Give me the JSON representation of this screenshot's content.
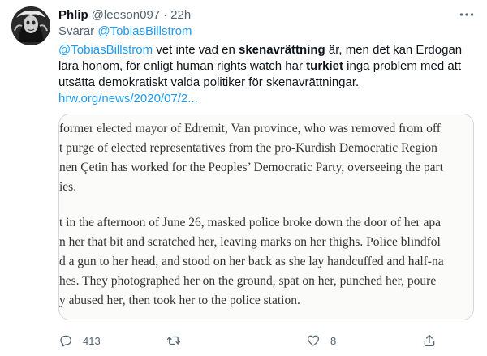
{
  "author": {
    "name": "Phlip",
    "handle": "@leeson097",
    "separator": "·",
    "time": "22h"
  },
  "reply": {
    "prefix": "Svarar",
    "mention": "@TobiasBillstrom"
  },
  "body": {
    "mention": "@TobiasBillstrom",
    "part1": " vet inte vad en ",
    "bold1": "skenavrättning",
    "part2": " är, men det kan Erdogan lära honom, för enligt human rights watch har ",
    "bold2": "turkiet",
    "part3": " inga problem med att utsätta demokratiskt valda politiker för skenavrättningar.",
    "link": "hrw.org/news/2020/07/2..."
  },
  "media": {
    "lines": [
      "former elected mayor of Edremit, Van province, who was removed from off",
      "t purge of elected representatives from the pro-Kurdish Democratic Region",
      "nen Çetin has worked for the Peoples’ Democratic Party, overseeing the part",
      "ies.",
      "t in the afternoon of June 26, masked police broke down the door of her apa",
      "n her that bit and scratched her, leaving marks on her thighs. Police blindfol",
      "d a gun to her head, and stood on her back as she lay handcuffed and half-na",
      "hes. They photographed her on the ground, spat on her, punched her, poure",
      "y abused her, then took her to the police station."
    ]
  },
  "actions": {
    "replies": "413",
    "retweets": "",
    "likes": "8"
  },
  "colors": {
    "link": "#1d9bf0",
    "secondary": "#536471",
    "text": "#0f1419",
    "border": "#cfd9de"
  },
  "icons": {
    "more": "more-dots-icon",
    "reply": "reply-bubble-icon",
    "retweet": "retweet-icon",
    "like": "heart-icon",
    "share": "share-icon"
  }
}
